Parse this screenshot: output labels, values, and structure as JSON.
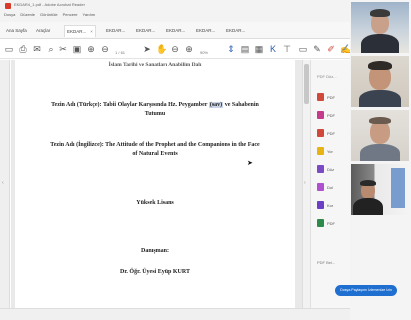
{
  "window": {
    "title": "EKDAR4_1.pdf - Adobe Acrobat Reader",
    "menu": [
      "Dosya",
      "Düzenle",
      "Görüntüle",
      "Pencere",
      "Yardım"
    ]
  },
  "tabs": [
    {
      "label": "Ana Sayfa"
    },
    {
      "label": "Araçlar"
    },
    {
      "label": "EKDAR...",
      "active": true
    },
    {
      "label": "EKDAR..."
    },
    {
      "label": "EKDAR..."
    },
    {
      "label": "EKDAR..."
    },
    {
      "label": "EKDAR..."
    },
    {
      "label": "EKDAR..."
    }
  ],
  "toolbar": {
    "page_current": "1",
    "page_total": "/ 61",
    "zoom": "90%"
  },
  "document": {
    "line_department": "İslam Tarihi ve Sanatları Anabilim Dalı",
    "thesis_tr_a": "Tezin Adı (Türkçe): Tabii Olaylar Karşısında Hz. Peygamber",
    "thesis_tr_highlight": "(sav)",
    "thesis_tr_b": "ve Sahabenin",
    "thesis_tr_c": "Tutumu",
    "thesis_en_a": "Tezin Adı (İngilizce): The Attitude of the Prophet and the Companions in the Face",
    "thesis_en_b": "of Natural Events",
    "degree": "Yüksek Lisans",
    "advisor_label": "Danışman:",
    "advisor_name": "Dr. Öğr. Üyesi Eyüp KURT"
  },
  "tools_pane": {
    "header": "PDF Düz...",
    "items": [
      {
        "label": "PDF",
        "color": "#d04a3c"
      },
      {
        "label": "PDF",
        "color": "#c43b8c"
      },
      {
        "label": "PDF",
        "color": "#d04a3c"
      },
      {
        "label": "Yor",
        "color": "#e7b416"
      },
      {
        "label": "Düz",
        "color": "#7b4bc4"
      },
      {
        "label": "Dol",
        "color": "#b04fd0"
      },
      {
        "label": "Kor",
        "color": "#6c3fc4"
      },
      {
        "label": "PDF",
        "color": "#2e8a4a"
      }
    ],
    "footer": "PDF Bel..."
  },
  "chat": {
    "bubble_text": "Dosya Paylaşımı İzlemenize İzin"
  },
  "colors": {
    "accent": "#1f6fd1",
    "highlight": "#c9d4e6"
  }
}
